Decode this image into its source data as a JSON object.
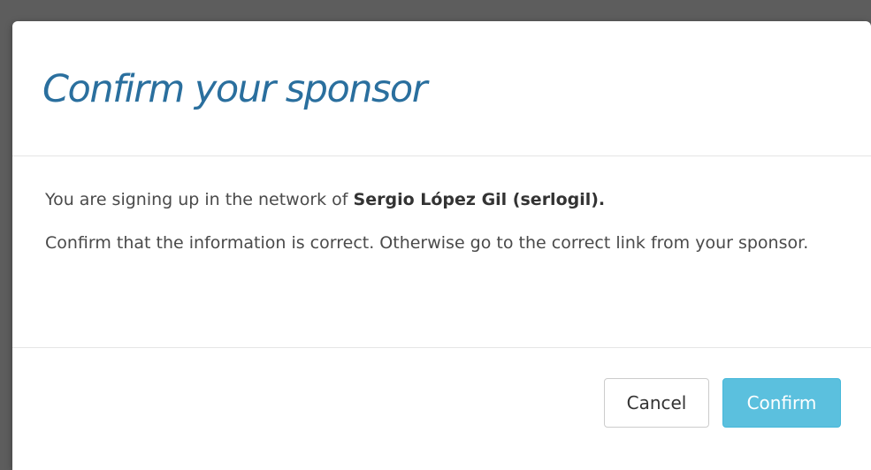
{
  "dialog": {
    "title": "Confirm your sponsor",
    "message_prefix": "You are signing up in the network of ",
    "sponsor_name": "Sergio López Gil (serlogil).",
    "message_secondary": "Confirm that the information is correct. Otherwise go to the correct link from your sponsor.",
    "cancel_label": "Cancel",
    "confirm_label": "Confirm"
  },
  "colors": {
    "title": "#2a6f9e",
    "confirm_button": "#5bc0de",
    "overlay": "#5d5d5d"
  }
}
